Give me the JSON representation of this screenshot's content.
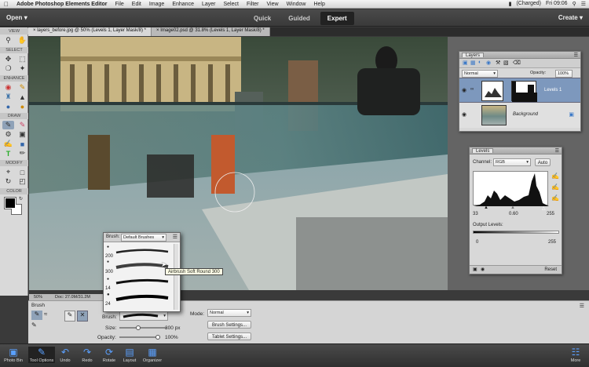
{
  "menubar": {
    "apple": "",
    "app": "Adobe Photoshop Elements Editor",
    "items": [
      "File",
      "Edit",
      "Image",
      "Enhance",
      "Layer",
      "Select",
      "Filter",
      "View",
      "Window",
      "Help"
    ],
    "battery": "(Charged)",
    "clock": "Fri 09:06"
  },
  "appbar": {
    "open_label": "Open",
    "modes": [
      "Quick",
      "Guided",
      "Expert"
    ],
    "active_mode": "Expert",
    "create_label": "Create"
  },
  "tabs": [
    {
      "label": "layers_before.jpg @ 50% (Levels 1, Layer Mask/8) *",
      "active": true
    },
    {
      "label": "Image02.psd @ 31.8% (Levels 1, Layer Mask/8) *",
      "active": false
    }
  ],
  "toolbox": {
    "sections": [
      "VIEW",
      "SELECT",
      "ENHANCE",
      "DRAW",
      "MODIFY",
      "COLOR"
    ]
  },
  "layers_panel": {
    "title": "Layers",
    "blend_mode": "Normal",
    "opacity_label": "Opacity:",
    "opacity_value": "100%",
    "layers": [
      {
        "name": "Levels 1",
        "selected": true
      },
      {
        "name": "Background",
        "selected": false
      }
    ]
  },
  "levels_panel": {
    "title": "Levels",
    "channel_label": "Channel:",
    "channel_value": "RGB",
    "auto_label": "Auto",
    "input_values": [
      "33",
      "0.60",
      "255"
    ],
    "output_label": "Output Levels:",
    "output_values": [
      "0",
      "255"
    ],
    "reset_label": "Reset"
  },
  "brush_picker": {
    "brush_label": "Brush:",
    "set_name": "Default Brushes",
    "sizes": [
      "200",
      "300",
      "14",
      "24"
    ],
    "tooltip": "Airbrush Soft Round 300"
  },
  "status": {
    "zoom": "50%",
    "doc": "Doc: 27.0M/31.2M"
  },
  "tool_options": {
    "tool_name": "Brush",
    "brush_label": "Brush:",
    "size_label": "Size:",
    "size_value": "300 px",
    "size_fraction": 0.38,
    "opacity_label": "Opacity:",
    "opacity_value": "100%",
    "opacity_fraction": 1.0,
    "mode_label": "Mode:",
    "mode_value": "Normal",
    "brush_settings": "Brush Settings...",
    "tablet_settings": "Tablet Settings..."
  },
  "taskbar": {
    "items": [
      "Photo Bin",
      "Tool Options",
      "Undo",
      "Redo",
      "Rotate",
      "Layout",
      "Organizer"
    ],
    "more": "More"
  },
  "colors": {
    "accent": "#5aa0ff",
    "selected_layer": "#7d98bd"
  }
}
